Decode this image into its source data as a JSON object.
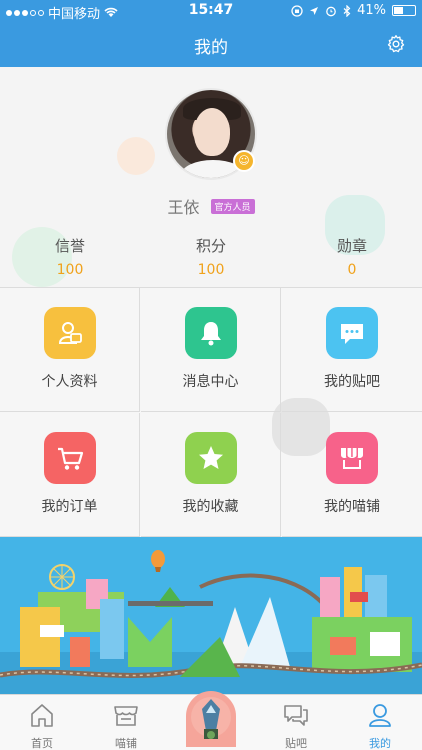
{
  "status_bar": {
    "carrier": "中国移动",
    "time": "15:47",
    "battery": "41%"
  },
  "nav": {
    "title": "我的"
  },
  "profile": {
    "name": "王依",
    "tag": "官方人员",
    "stats": [
      {
        "label": "信誉",
        "value": "100"
      },
      {
        "label": "积分",
        "value": "100"
      },
      {
        "label": "勋章",
        "value": "0"
      }
    ]
  },
  "grid": [
    {
      "label": "个人资料",
      "icon": "profile-card-icon",
      "color": "#f7c03e"
    },
    {
      "label": "消息中心",
      "icon": "bell-icon",
      "color": "#2ec58f"
    },
    {
      "label": "我的贴吧",
      "icon": "chat-bubble-icon",
      "color": "#4cc3f1"
    },
    {
      "label": "我的订单",
      "icon": "cart-icon",
      "color": "#f56464"
    },
    {
      "label": "我的收藏",
      "icon": "star-icon",
      "color": "#8fd14f"
    },
    {
      "label": "我的喵铺",
      "icon": "shop-icon",
      "color": "#f7628a"
    }
  ],
  "tabbar": [
    {
      "label": "首页",
      "icon": "home-icon"
    },
    {
      "label": "喵铺",
      "icon": "store-icon"
    },
    {
      "label": "贴吧",
      "icon": "forum-icon"
    },
    {
      "label": "我的",
      "icon": "user-icon",
      "active": true
    }
  ],
  "colors": {
    "primary": "#3a9ae0",
    "accent": "#f0a21b"
  }
}
